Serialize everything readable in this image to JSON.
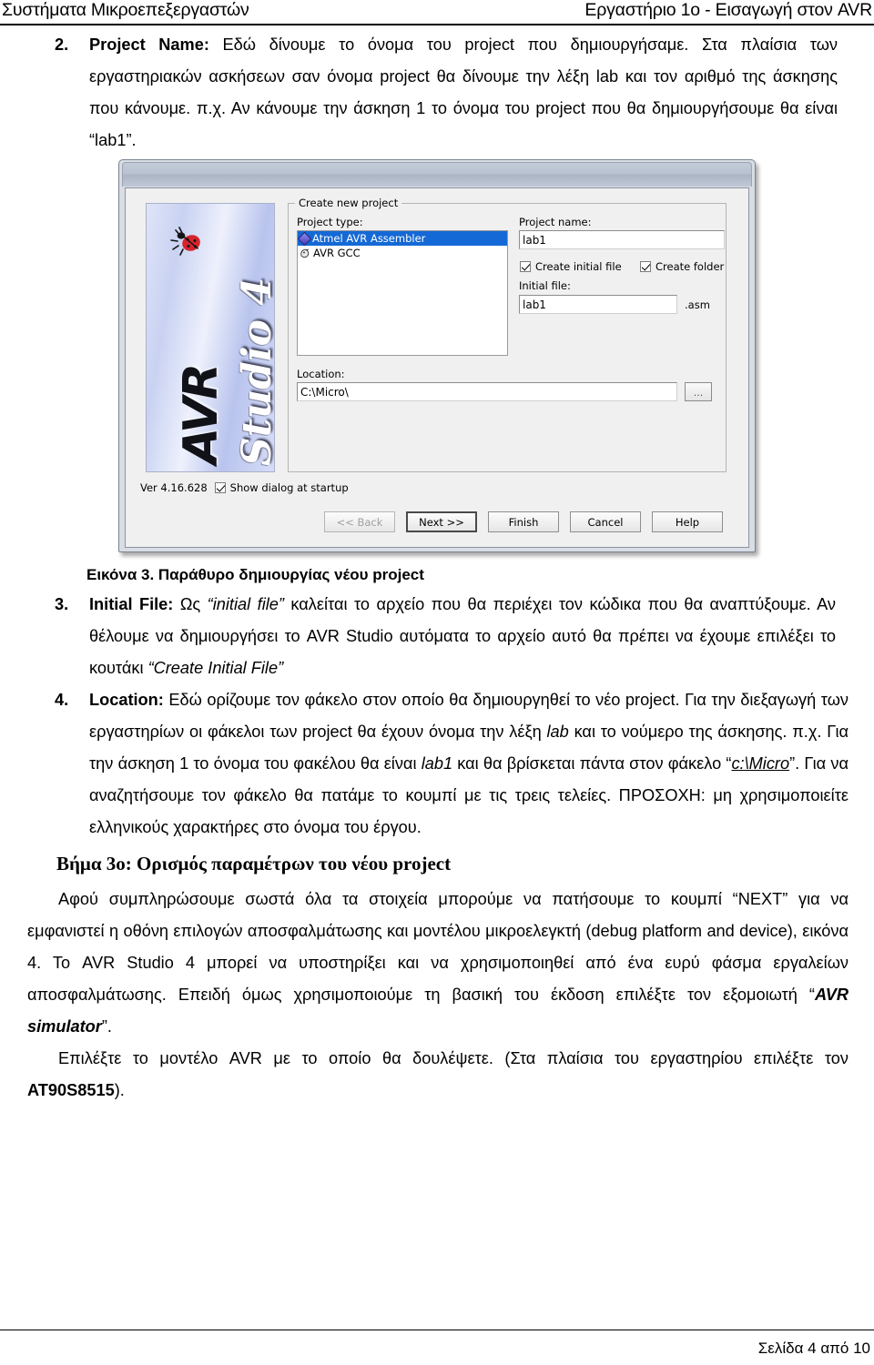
{
  "header": {
    "left": "Συστήματα Μικροεπεξεργαστών",
    "right": "Εργαστήριο 1ο - Εισαγωγή στον AVR"
  },
  "items": {
    "item2": {
      "number": "2.",
      "term": "Project Name:",
      "text_a": " Εδώ δίνουμε το όνομα του project που δημιουργήσαμε. Στα πλαίσια των εργαστηριακών ασκήσεων σαν όνομα project θα δίνουμε την λέξη lab και τον αριθμό της άσκησης που κάνουμε. π.χ. Αν κάνουμε την άσκηση 1 το όνομα του project που θα δημιουργήσουμε θα είναι “lab1”."
    },
    "item3": {
      "number": "3.",
      "term": "Initial File:",
      "text_a": " Ως ",
      "quote_a": "“initial file”",
      "text_b": " καλείται το αρχείο που θα περιέχει τον κώδικα που θα αναπτύξουμε. Αν θέλουμε να δημιουργήσει το AVR Studio αυτόματα το αρχείο αυτό θα πρέπει να έχουμε επιλέξει το κουτάκι ",
      "quote_b": "“Create Initial File”"
    },
    "item4": {
      "number": "4.",
      "term": "Location:",
      "text_a": " Εδώ ορίζουμε τον φάκελο στον οποίο θα δημιουργηθεί το νέο project. Για την διεξαγωγή των εργαστηρίων οι φάκελοι των project θα έχουν όνομα την λέξη ",
      "em_a": "lab",
      "text_b": " και το νούμερο της άσκησης. π.χ. Για την άσκηση 1 το όνομα του φακέλου θα είναι ",
      "em_b": "lab1",
      "text_c": " και θα βρίσκεται πάντα στον φάκελο “",
      "link": "c:\\Micro",
      "text_d": "”. Για να αναζητήσουμε τον φάκελο θα πατάμε το κουμπί με τις τρεις τελείες. ΠΡΟΣΟΧΗ: μη χρησιμοποιείτε ελληνικούς χαρακτήρες στο όνομα του έργου."
    }
  },
  "figure": {
    "caption": "Εικόνα 3. Παράθυρο δημιουργίας νέου project",
    "dialog": {
      "logo": {
        "avr": "AVR",
        "studio": "Studio 4",
        "bug_icon": "ladybug-icon"
      },
      "group_title": "Create new project",
      "project_type_label": "Project type:",
      "project_types": [
        {
          "label": "Atmel AVR Assembler",
          "icon": "atmel-diamond-icon",
          "selected": true
        },
        {
          "label": "AVR GCC",
          "icon": "gcc-gnu-icon",
          "selected": false
        }
      ],
      "project_name_label": "Project name:",
      "project_name_value": "lab1",
      "create_initial_file_label": "Create initial file",
      "create_initial_file_checked": true,
      "create_folder_label": "Create folder",
      "create_folder_checked": true,
      "initial_file_label": "Initial file:",
      "initial_file_value": "lab1",
      "initial_file_ext": ".asm",
      "location_label": "Location:",
      "location_value": "C:\\Micro\\",
      "browse_label": "...",
      "version": "Ver 4.16.628",
      "show_dialog_label": "Show dialog at startup",
      "show_dialog_checked": true,
      "buttons": [
        {
          "label": "<< Back",
          "state": "disabled"
        },
        {
          "label": "Next >>",
          "state": "default"
        },
        {
          "label": "Finish",
          "state": "normal"
        },
        {
          "label": "Cancel",
          "state": "normal"
        },
        {
          "label": "Help",
          "state": "normal"
        }
      ]
    }
  },
  "step3": {
    "heading": "Βήμα 3ο: Ορισμός παραμέτρων του νέου project",
    "para1_a": "Αφού συμπληρώσουμε σωστά όλα τα στοιχεία μπορούμε να πατήσουμε το κουμπί “NEXT” για να εμφανιστεί η οθόνη επιλογών αποσφαλμάτωσης και μοντέλου μικροελεγκτή (debug platform and device), εικόνα 4. Το AVR Studio 4 μπορεί να υποστηρίξει και να χρησιμοποιηθεί από ένα ευρύ φάσμα εργαλείων αποσφαλμάτωσης. Επειδή όμως χρησιμοποιούμε τη βασική του έκδοση επιλέξτε τον εξομοιωτή “",
    "para1_em": "AVR simulator",
    "para1_b": "”.",
    "para2_a": "Επιλέξτε το μοντέλο AVR με το οποίο θα δουλέψετε. (Στα πλαίσια του εργαστηρίου επιλέξτε τον ",
    "para2_bold": "AT90S8515",
    "para2_b": ")."
  },
  "footer": {
    "page_text": "Σελίδα 4 από 10"
  }
}
